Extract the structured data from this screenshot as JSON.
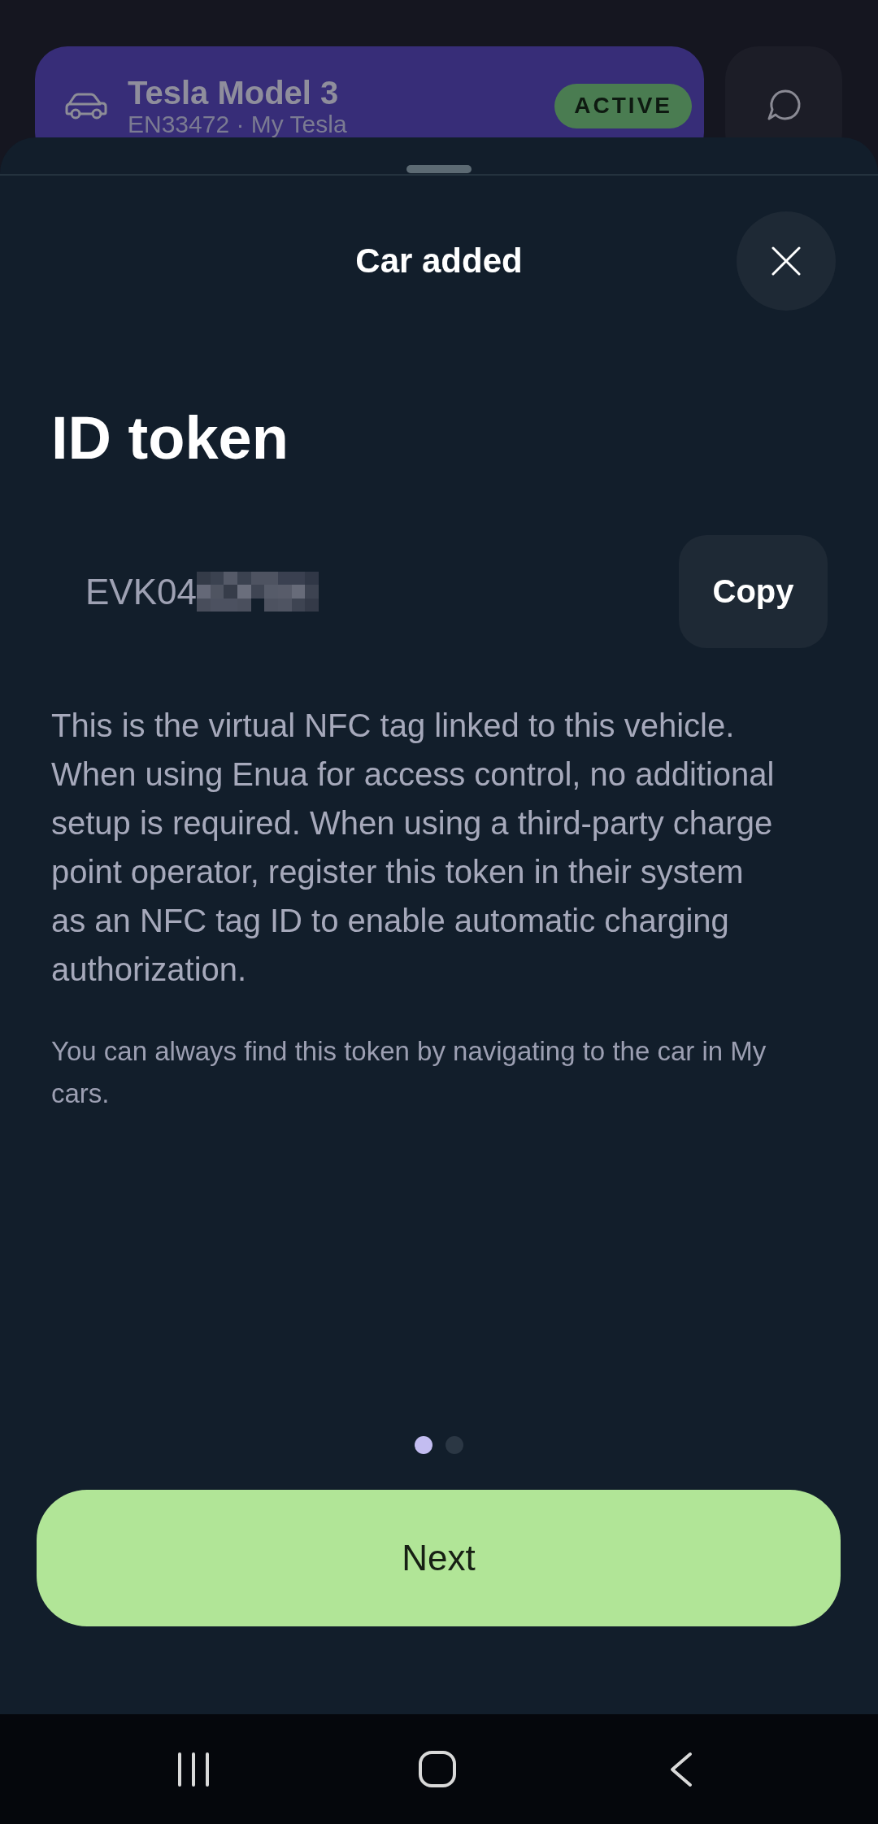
{
  "background_screen": {
    "car_card": {
      "name": "Tesla Model 3",
      "details": "EN33472 · My Tesla",
      "status_badge": "ACTIVE"
    }
  },
  "sheet": {
    "title": "Car added",
    "heading": "ID token",
    "token": {
      "value": "EVK04",
      "redacted": true
    },
    "copy_button": "Copy",
    "description": "This is the virtual NFC tag linked to this vehicle. When using Enua for access control, no additional setup is required. When using a third-party charge point operator, register this token in their system as an NFC tag ID to enable automatic charging authorization.",
    "note": "You can always find this token by navigating to the car in My cars.",
    "pager": [
      {
        "selected": true
      },
      {
        "selected": false
      }
    ],
    "next_button": "Next"
  }
}
